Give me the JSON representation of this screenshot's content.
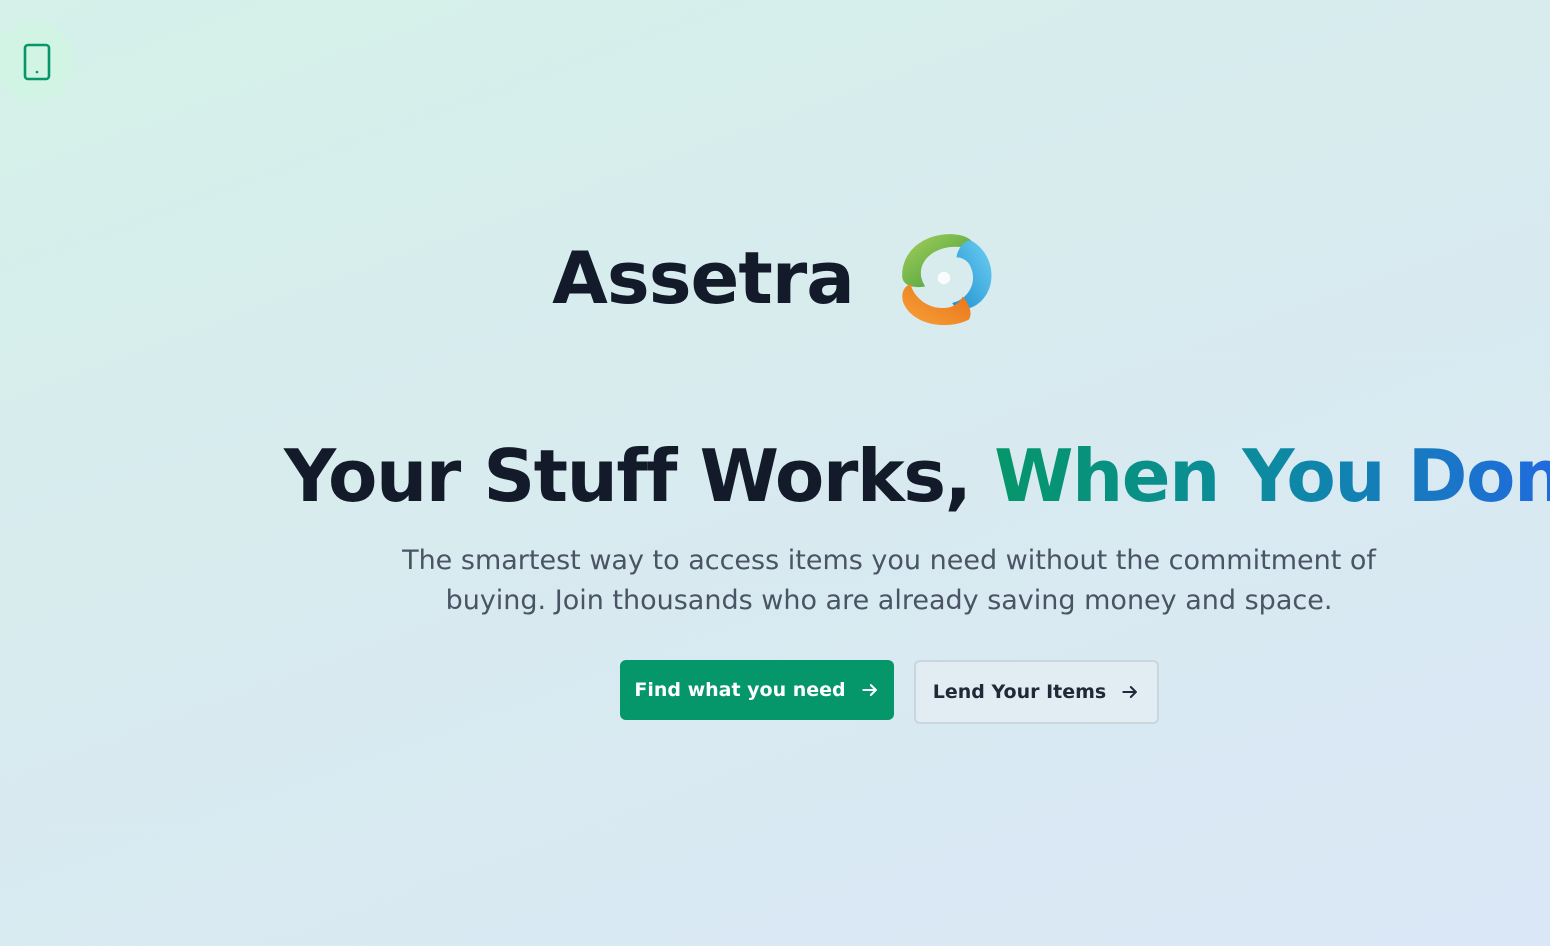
{
  "brand": {
    "name": "Assetra"
  },
  "hero": {
    "headline_plain": "Your Stuff Works, ",
    "headline_accent": "When You Don't",
    "subtitle_line1": "The smartest way to access items you need without the commitment of",
    "subtitle_line2": "buying. Join thousands who are already saving money and space."
  },
  "actions": {
    "primary_label": "Find what you need",
    "secondary_label": "Lend Your Items"
  },
  "icons": {
    "device": "tablet-icon",
    "primary_arrow": "arrow-right-icon",
    "secondary_arrow": "arrow-right-icon",
    "logo": "assetra-logo"
  },
  "colors": {
    "primary": "#059669",
    "headline_dark": "#131b2b",
    "accent_gradient": [
      "#059669",
      "#0d8aa2",
      "#2563eb"
    ],
    "logo_green": "#7cc242",
    "logo_blue": "#3aa9e0",
    "logo_orange": "#f7941d"
  }
}
